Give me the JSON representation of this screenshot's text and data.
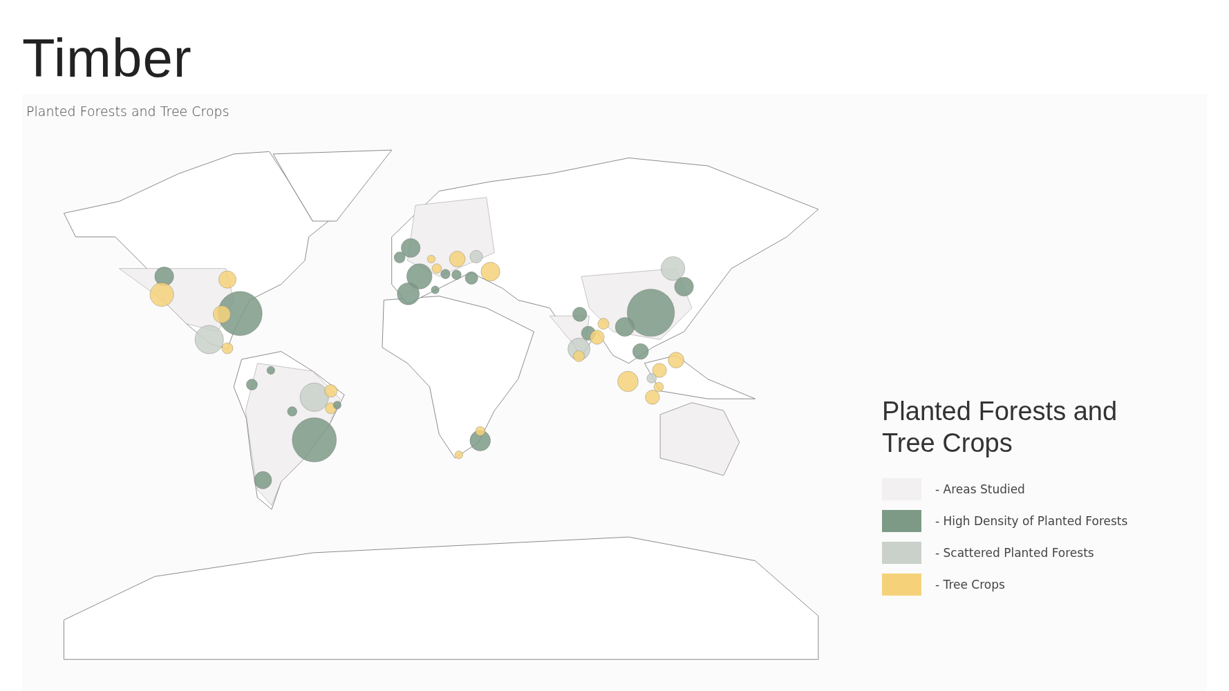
{
  "title": "Timber",
  "subtitle": "Planted Forests and Tree Crops",
  "legend": {
    "title": "Planted Forests and Tree Crops",
    "items": [
      {
        "label": "- Areas Studied",
        "color": "#f2f0f1"
      },
      {
        "label": "- High Density of Planted Forests",
        "color": "#7d9a86"
      },
      {
        "label": "- Scattered Planted Forests",
        "color": "#c9d1ca"
      },
      {
        "label": "- Tree Crops",
        "color": "#f5d27a"
      }
    ]
  }
}
